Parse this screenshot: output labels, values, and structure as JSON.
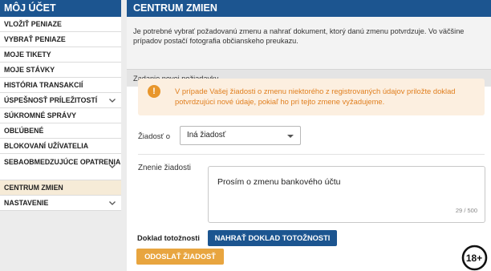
{
  "sidebar": {
    "title": "MÔJ ÚČET",
    "items": [
      {
        "label": "VLOŽIŤ PENIAZE",
        "has_chevron": false
      },
      {
        "label": "VYBRAŤ PENIAZE",
        "has_chevron": false
      },
      {
        "label": "MOJE TIKETY",
        "has_chevron": false
      },
      {
        "label": "MOJE STÁVKY",
        "has_chevron": false
      },
      {
        "label": "HISTÓRIA TRANSAKCIÍ",
        "has_chevron": false
      },
      {
        "label": "ÚSPEŠNOSŤ PRÍLEŽITOSTÍ",
        "has_chevron": true
      },
      {
        "label": "SÚKROMNÉ SPRÁVY",
        "has_chevron": false
      },
      {
        "label": "OBĽÚBENÉ",
        "has_chevron": false
      },
      {
        "label": "BLOKOVANÍ UŽÍVATELIA",
        "has_chevron": false
      },
      {
        "label": "SEBAOBMEDZUJÚCE OPATRENIA",
        "has_chevron": true
      },
      {
        "label": "CENTRUM ZMIEN",
        "has_chevron": false,
        "active": true
      },
      {
        "label": "NASTAVENIE",
        "has_chevron": true
      }
    ]
  },
  "main": {
    "title": "CENTRUM ZMIEN",
    "intro": "Je potrebné vybrať požadovanú zmenu a nahrať dokument, ktorý danú zmenu potvrdzuje. Vo väčšine prípadov postačí fotografia občianskeho preukazu.",
    "section_title": "Zadanie novej požiadavky",
    "alert": {
      "icon": "!",
      "text": "V prípade Vašej žiadosti o zmenu niektorého z registrovaných údajov priložte doklad potvrdzujúci nové údaje, pokiaľ ho pri tejto zmene vyžadujeme."
    },
    "request_label": "Žiadosť o",
    "request_value": "Iná žiadosť",
    "reason_label": "Znenie žiadosti",
    "reason_value": "Prosím o zmenu bankového účtu",
    "reason_counter": "29 / 500",
    "doc_label": "Doklad totožnosti",
    "upload_button": "NAHRAŤ DOKLAD TOTOŽNOSTI",
    "send_button": "ODOSLAŤ ŽIADOSŤ",
    "age_badge": "18+"
  },
  "colors": {
    "header_blue": "#1c5590",
    "accent_orange": "#e8a53f",
    "alert_bg": "#fcefe0",
    "alert_text": "#e07f1f",
    "active_bg": "#f6ebd7"
  }
}
